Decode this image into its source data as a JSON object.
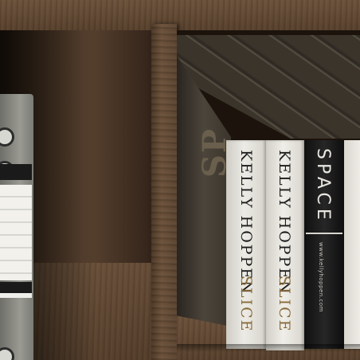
{
  "books": [
    {
      "author": "KELLY HOPPEN",
      "title": "SLICE"
    },
    {
      "author": "KELLY HOPPEN",
      "title": "SLICE"
    },
    {
      "title": "SPACE",
      "subtitle": "www.kellyhoppen.com"
    }
  ],
  "tilted_book": {
    "text": "SP"
  },
  "colors": {
    "wood": "#5e4631",
    "cubby_shadow": "#1b130c",
    "book_white": "#e9e6df",
    "book_black": "#151515",
    "binder_gray": "#8d8d86"
  }
}
